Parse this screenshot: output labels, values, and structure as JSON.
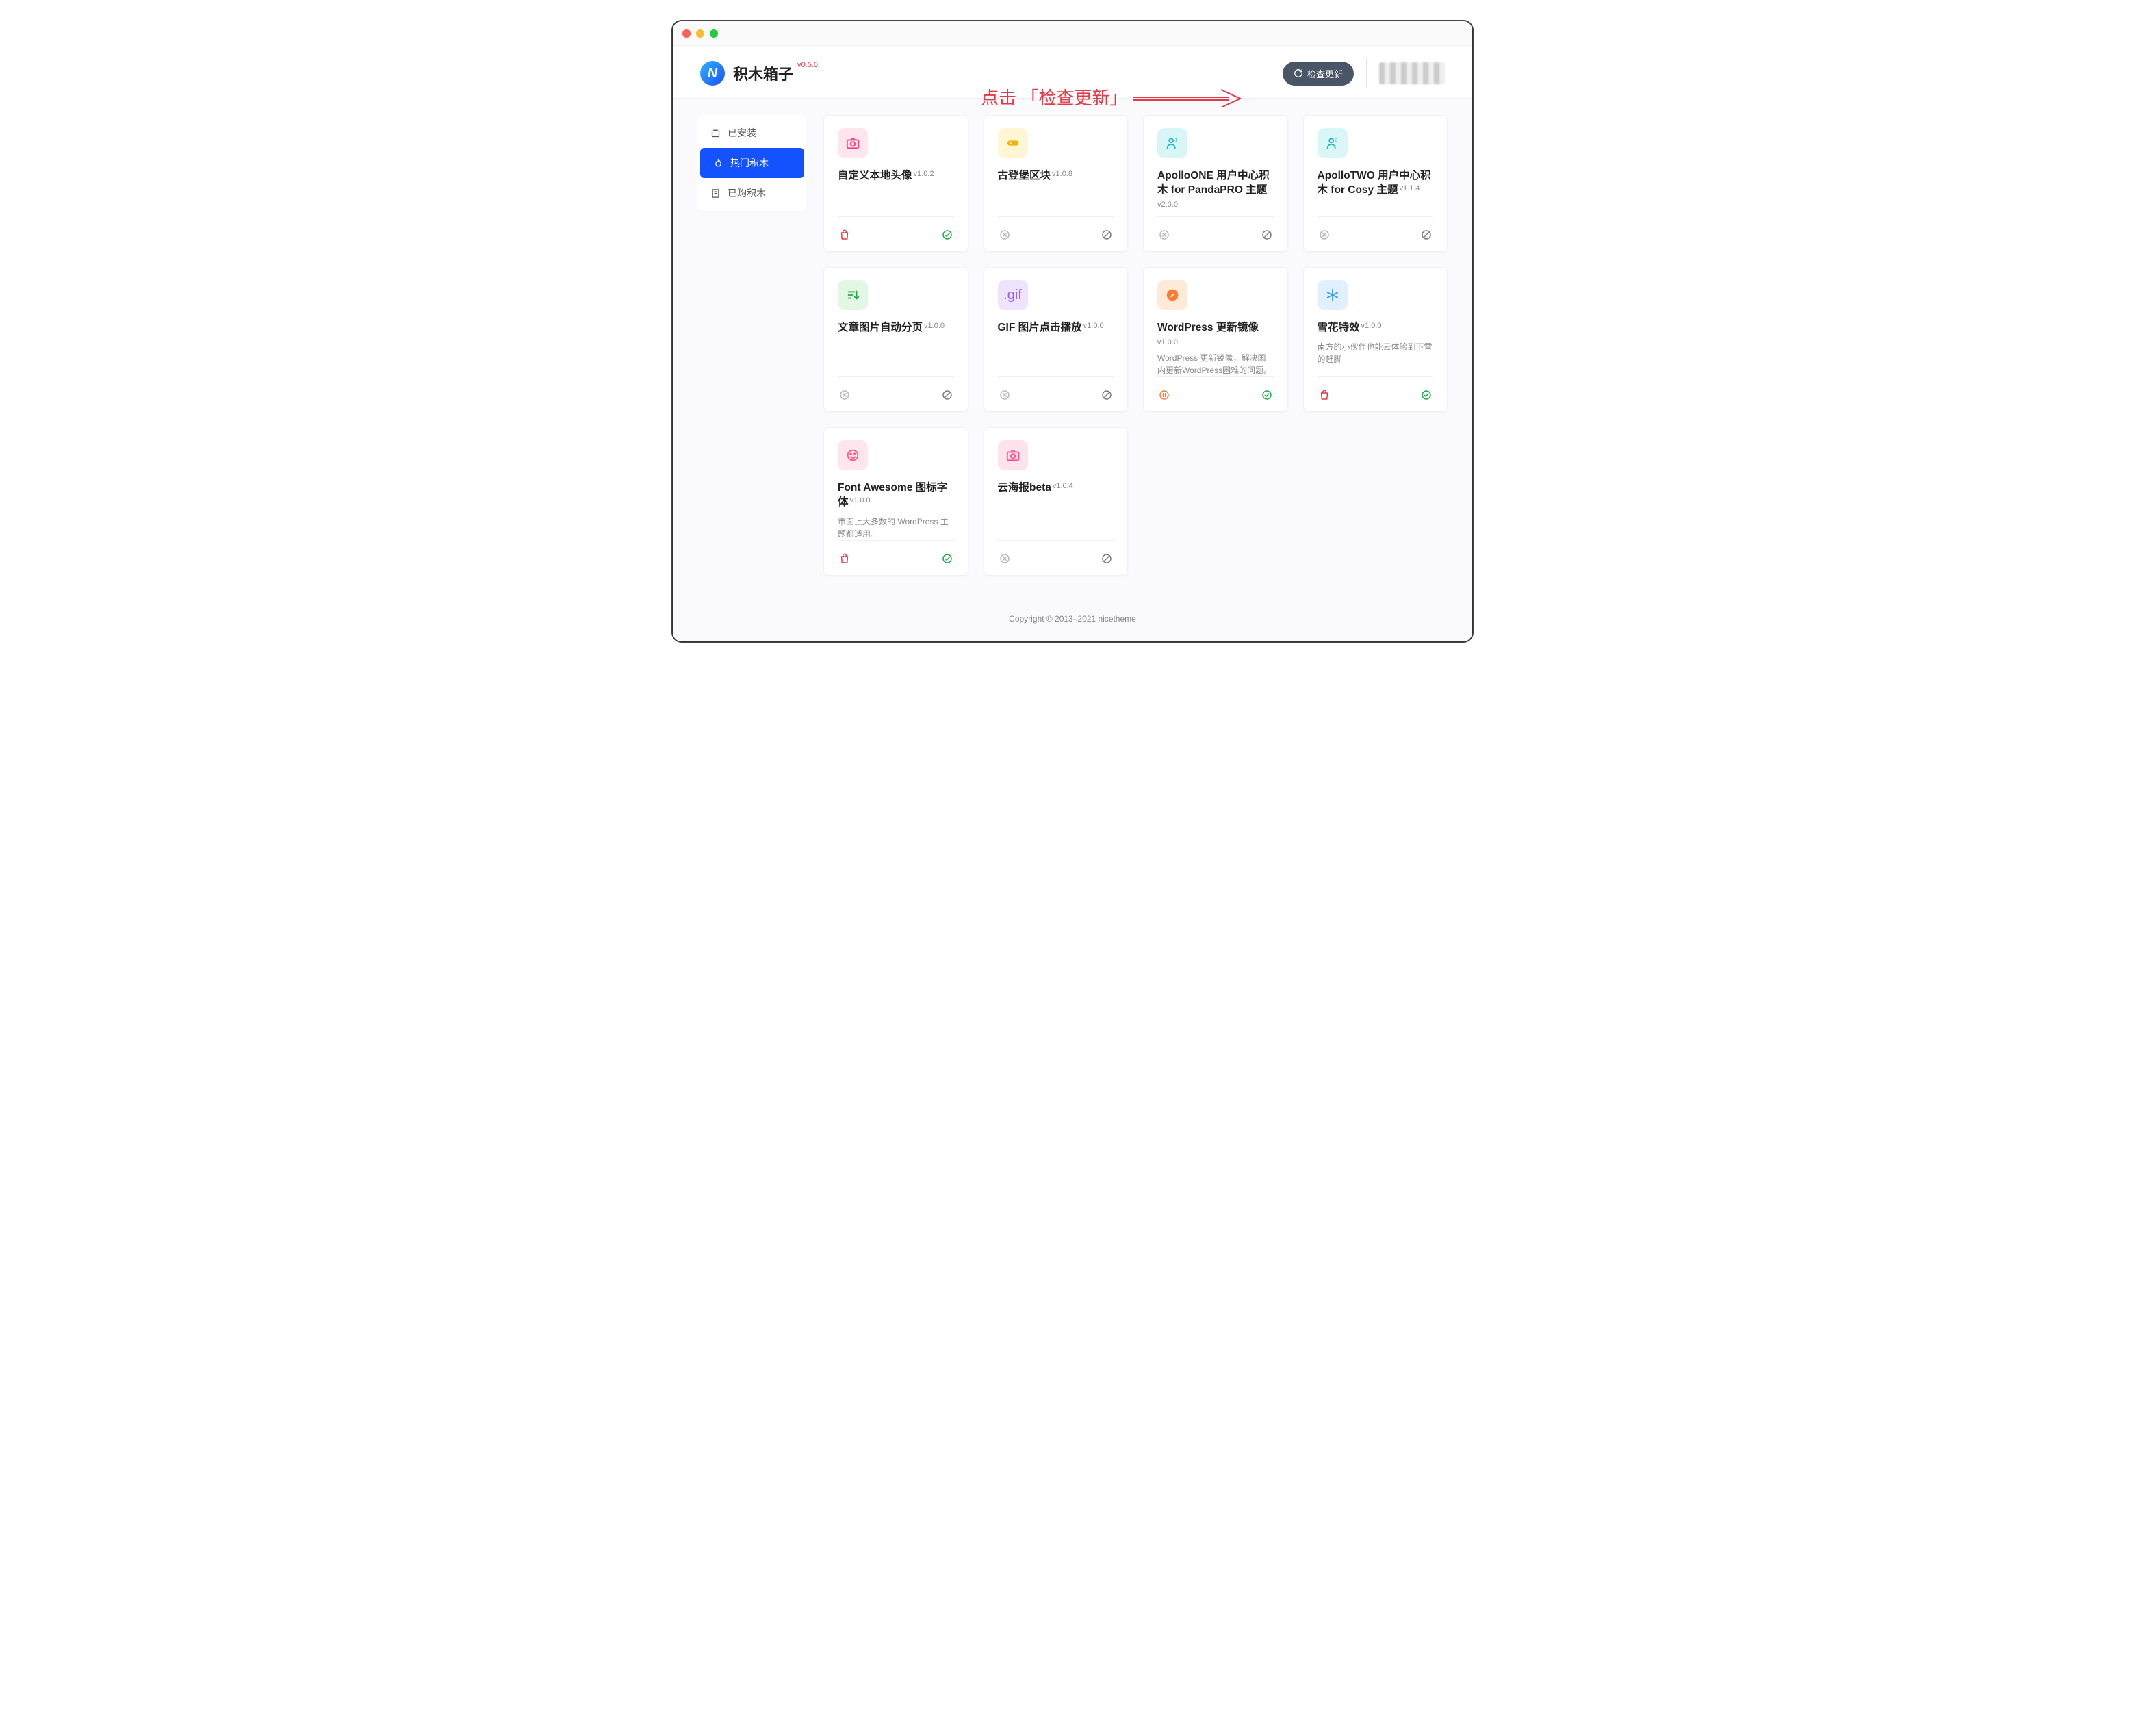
{
  "app": {
    "title": "积木箱子",
    "version": "v0.5.0"
  },
  "header": {
    "check_update": "检查更新"
  },
  "annotation": {
    "text": "点击 「检查更新」"
  },
  "sidebar": {
    "items": [
      {
        "label": "已安装"
      },
      {
        "label": "热门积木"
      },
      {
        "label": "已购积木"
      }
    ]
  },
  "cards": [
    {
      "title": "自定义本地头像",
      "version": "v1.0.2",
      "sub_version": "",
      "desc": "",
      "left_icon": "bag-red",
      "right_icon": "check-green"
    },
    {
      "title": "古登堡区块",
      "version": "v1.0.8",
      "sub_version": "",
      "desc": "",
      "left_icon": "x-grey",
      "right_icon": "ban-grey"
    },
    {
      "title": "ApolloONE 用户中心积木 for PandaPRO 主题",
      "version": "",
      "sub_version": "v2.0.0",
      "desc": "",
      "left_icon": "x-grey",
      "right_icon": "ban-grey"
    },
    {
      "title": "ApolloTWO 用户中心积木 for Cosy 主题",
      "version": "v1.1.4",
      "sub_version": "",
      "desc": "",
      "left_icon": "x-grey",
      "right_icon": "ban-grey"
    },
    {
      "title": "文章图片自动分页",
      "version": "v1.0.0",
      "sub_version": "",
      "desc": "",
      "left_icon": "x-grey",
      "right_icon": "ban-grey"
    },
    {
      "title": "GIF 图片点击播放",
      "version": "v1.0.0",
      "sub_version": "",
      "desc": "",
      "left_icon": "x-grey",
      "right_icon": "ban-grey"
    },
    {
      "title": "WordPress 更新镜像",
      "version": "",
      "sub_version": "v1.0.0",
      "desc": "WordPress 更新镜像，解决国内更新WordPress困难的问题。",
      "left_icon": "pause-orange",
      "right_icon": "check-green"
    },
    {
      "title": "雪花特效",
      "version": "v1.0.0",
      "sub_version": "",
      "desc": "南方的小伙伴也能云体验到下雪的赶脚",
      "left_icon": "bag-red",
      "right_icon": "check-green"
    },
    {
      "title": "Font Awesome 图标字体",
      "version": "v1.0.0",
      "sub_version": "",
      "desc": "市面上大多数的 WordPress 主题都适用。",
      "left_icon": "bag-red",
      "right_icon": "check-green"
    },
    {
      "title": "云海报beta",
      "version": "v1.0.4",
      "sub_version": "",
      "desc": "",
      "left_icon": "x-grey",
      "right_icon": "ban-grey"
    }
  ],
  "card_icons": [
    {
      "class": "ic-pink",
      "name": "camera-icon"
    },
    {
      "class": "ic-yellow",
      "name": "toggle-icon"
    },
    {
      "class": "ic-cyan",
      "name": "user-1-icon"
    },
    {
      "class": "ic-teal",
      "name": "user-2-icon"
    },
    {
      "class": "ic-green",
      "name": "sort-icon"
    },
    {
      "class": "ic-purple",
      "name": "gif-icon"
    },
    {
      "class": "ic-orange",
      "name": "compass-icon"
    },
    {
      "class": "ic-blue",
      "name": "snowflake-icon"
    },
    {
      "class": "ic-rose",
      "name": "smile-icon"
    },
    {
      "class": "ic-pink2",
      "name": "camera2-icon"
    }
  ],
  "footer": {
    "text": "Copyright © 2013–2021 nicetheme"
  }
}
